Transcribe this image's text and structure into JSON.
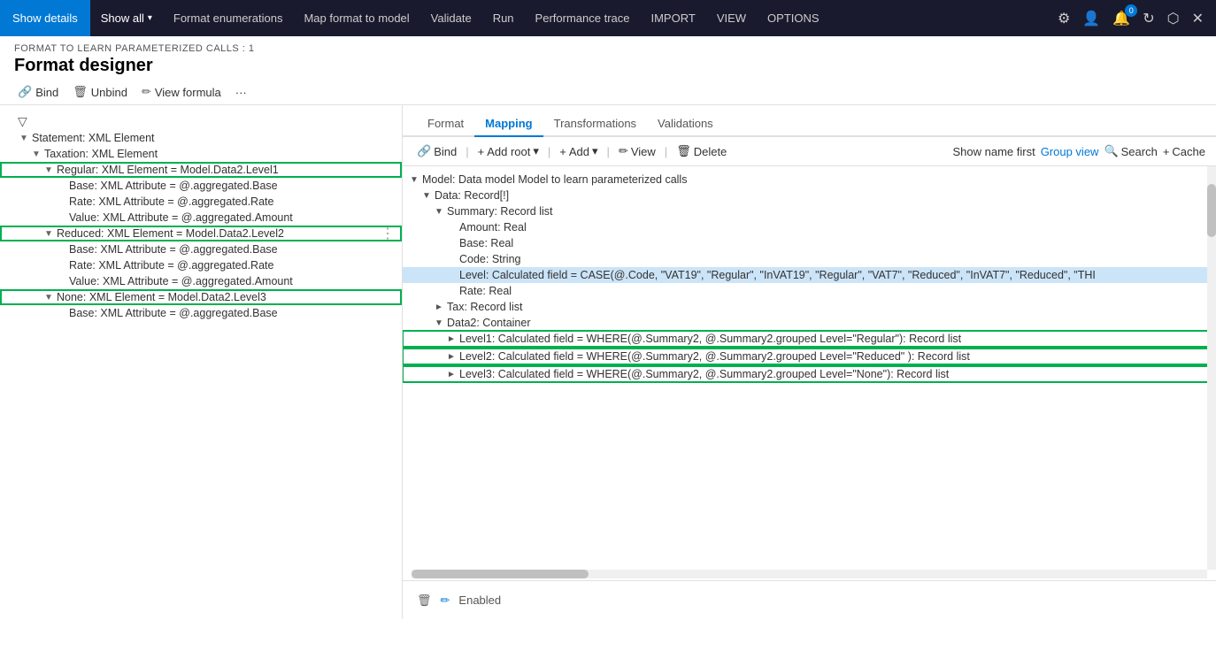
{
  "topNav": {
    "showDetails": "Show details",
    "items": [
      {
        "label": "Show all",
        "hasChevron": true
      },
      {
        "label": "Format enumerations"
      },
      {
        "label": "Map format to model"
      },
      {
        "label": "Validate"
      },
      {
        "label": "Run"
      },
      {
        "label": "Performance trace"
      },
      {
        "label": "IMPORT"
      },
      {
        "label": "VIEW"
      },
      {
        "label": "OPTIONS"
      }
    ],
    "badgeCount": "0"
  },
  "breadcrumb": "FORMAT TO LEARN PARAMETERIZED CALLS : 1",
  "pageTitle": "Format designer",
  "toolbar": {
    "bind": "Bind",
    "unbind": "Unbind",
    "viewFormula": "View formula",
    "more": "···"
  },
  "tabs": [
    "Format",
    "Mapping",
    "Transformations",
    "Validations"
  ],
  "activeTab": "Mapping",
  "mappingToolbar": {
    "bind": "Bind",
    "addRoot": "Add root",
    "add": "Add",
    "view": "View",
    "delete": "Delete",
    "showNameFirst": "Show name first",
    "groupView": "Group view",
    "search": "Search",
    "cache": "Cache"
  },
  "leftTree": {
    "items": [
      {
        "indent": 0,
        "toggle": "▼",
        "label": "Statement: XML Element",
        "highlighted": false
      },
      {
        "indent": 1,
        "toggle": "▼",
        "label": "Taxation: XML Element",
        "highlighted": false
      },
      {
        "indent": 2,
        "toggle": "▼",
        "label": "Regular: XML Element = Model.Data2.Level1",
        "highlighted": true
      },
      {
        "indent": 3,
        "toggle": "",
        "label": "Base: XML Attribute = @.aggregated.Base",
        "highlighted": false
      },
      {
        "indent": 3,
        "toggle": "",
        "label": "Rate: XML Attribute = @.aggregated.Rate",
        "highlighted": false
      },
      {
        "indent": 3,
        "toggle": "",
        "label": "Value: XML Attribute = @.aggregated.Amount",
        "highlighted": false
      },
      {
        "indent": 2,
        "toggle": "▼",
        "label": "Reduced: XML Element = Model.Data2.Level2",
        "highlighted": true
      },
      {
        "indent": 3,
        "toggle": "",
        "label": "Base: XML Attribute = @.aggregated.Base",
        "highlighted": false
      },
      {
        "indent": 3,
        "toggle": "",
        "label": "Rate: XML Attribute = @.aggregated.Rate",
        "highlighted": false
      },
      {
        "indent": 3,
        "toggle": "",
        "label": "Value: XML Attribute = @.aggregated.Amount",
        "highlighted": false
      },
      {
        "indent": 2,
        "toggle": "▼",
        "label": "None: XML Element = Model.Data2.Level3",
        "highlighted": true
      },
      {
        "indent": 3,
        "toggle": "",
        "label": "Base: XML Attribute = @.aggregated.Base",
        "highlighted": false
      }
    ]
  },
  "mappingTree": {
    "items": [
      {
        "indent": 0,
        "toggle": "▼",
        "label": "Model: Data model Model to learn parameterized calls",
        "highlighted": false
      },
      {
        "indent": 1,
        "toggle": "▼",
        "label": "Data: Record[!]",
        "highlighted": false
      },
      {
        "indent": 2,
        "toggle": "▼",
        "label": "Summary: Record list",
        "highlighted": false
      },
      {
        "indent": 3,
        "toggle": "",
        "label": "Amount: Real",
        "highlighted": false
      },
      {
        "indent": 3,
        "toggle": "",
        "label": "Base: Real",
        "highlighted": false
      },
      {
        "indent": 3,
        "toggle": "",
        "label": "Code: String",
        "highlighted": false
      },
      {
        "indent": 3,
        "toggle": "",
        "label": "Level: Calculated field = CASE(@.Code, \"VAT19\", \"Regular\", \"InVAT19\", \"Regular\", \"VAT7\", \"Reduced\", \"InVAT7\", \"Reduced\", \"THI",
        "highlighted": true,
        "isBlueHighlight": true
      },
      {
        "indent": 3,
        "toggle": "",
        "label": "Rate: Real",
        "highlighted": false
      },
      {
        "indent": 2,
        "toggle": "►",
        "label": "Tax: Record list",
        "highlighted": false
      },
      {
        "indent": 2,
        "toggle": "▼",
        "label": "Data2: Container",
        "highlighted": false
      },
      {
        "indent": 3,
        "toggle": "►",
        "label": "Level1: Calculated field = WHERE(@.Summary2, @.Summary2.grouped Level=\"Regular\"): Record list",
        "highlighted": true,
        "greenBox": true
      },
      {
        "indent": 3,
        "toggle": "►",
        "label": "Level2: Calculated field = WHERE(@.Summary2, @.Summary2.grouped Level=\"Reduced\" ): Record list",
        "highlighted": true,
        "greenBox": true
      },
      {
        "indent": 3,
        "toggle": "►",
        "label": "Level3: Calculated field = WHERE(@.Summary2, @.Summary2.grouped Level=\"None\"): Record list",
        "highlighted": true,
        "greenBox": true
      }
    ]
  },
  "bottomBar": {
    "status": "Enabled"
  }
}
